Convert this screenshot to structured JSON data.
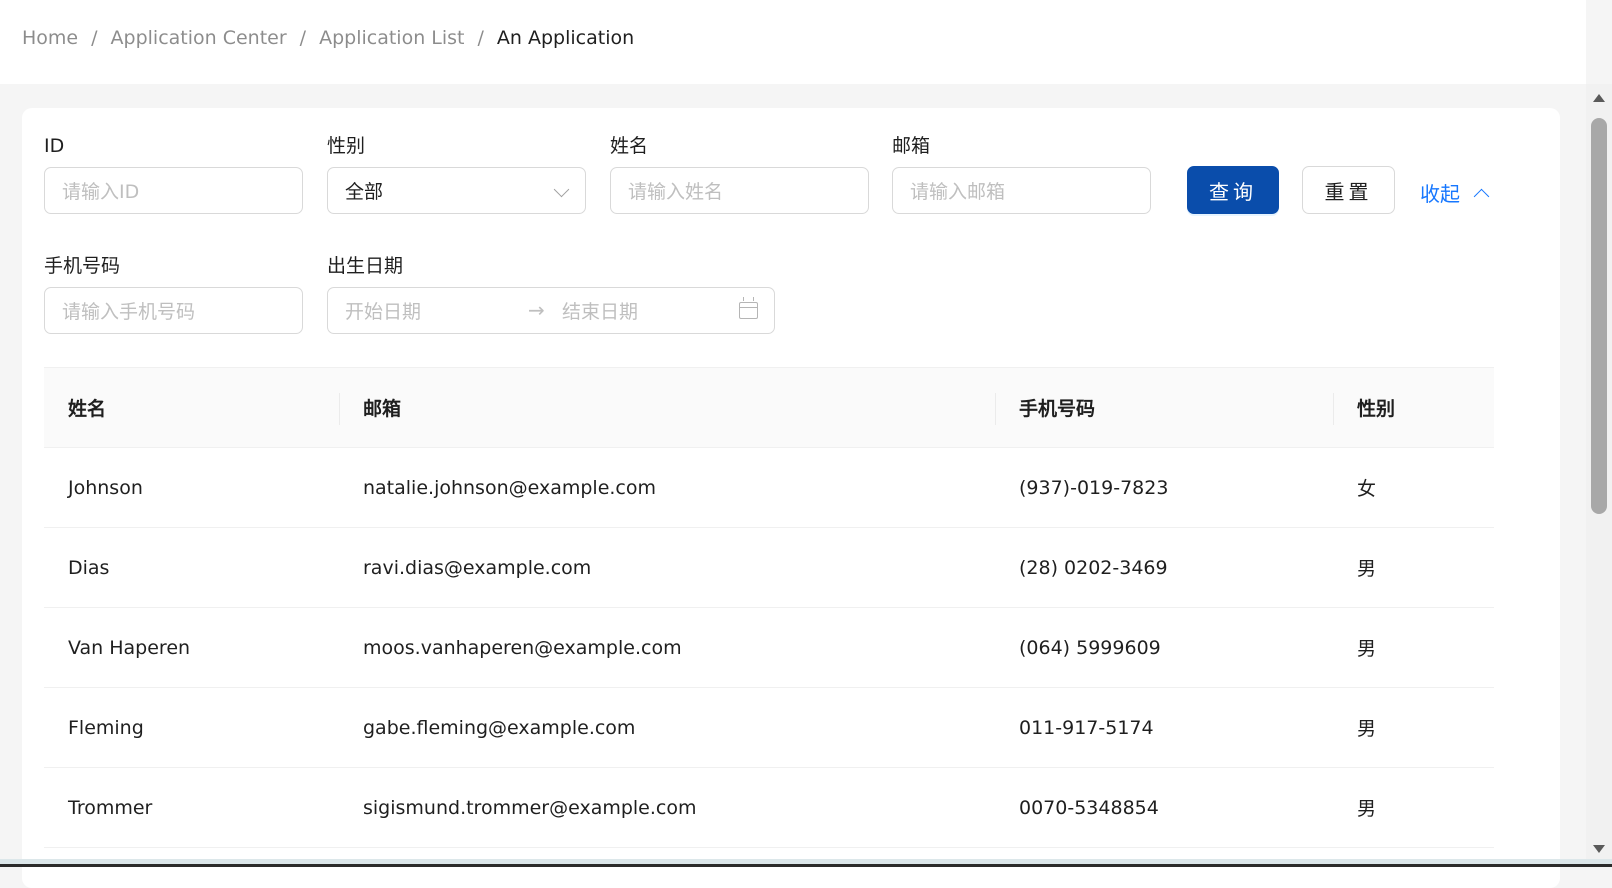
{
  "breadcrumb": {
    "items": [
      "Home",
      "Application Center",
      "Application List",
      "An Application"
    ],
    "separator": "/"
  },
  "filters": {
    "id": {
      "label": "ID",
      "placeholder": "请输入ID",
      "value": ""
    },
    "gender": {
      "label": "性别",
      "value": "全部"
    },
    "name": {
      "label": "姓名",
      "placeholder": "请输入姓名",
      "value": ""
    },
    "email": {
      "label": "邮箱",
      "placeholder": "请输入邮箱",
      "value": ""
    },
    "phone": {
      "label": "手机号码",
      "placeholder": "请输入手机号码",
      "value": ""
    },
    "birthdate": {
      "label": "出生日期",
      "start_placeholder": "开始日期",
      "end_placeholder": "结束日期",
      "arrow": "→"
    }
  },
  "actions": {
    "query_label": "查询",
    "reset_label": "重置",
    "collapse_label": "收起"
  },
  "table": {
    "columns": [
      "姓名",
      "邮箱",
      "手机号码",
      "性别"
    ],
    "rows": [
      [
        "Johnson",
        "natalie.johnson@example.com",
        "(937)-019-7823",
        "女"
      ],
      [
        "Dias",
        "ravi.dias@example.com",
        "(28) 0202-3469",
        "男"
      ],
      [
        "Van Haperen",
        "moos.vanhaperen@example.com",
        "(064) 5999609",
        "男"
      ],
      [
        "Fleming",
        "gabe.fleming@example.com",
        "011-917-5174",
        "男"
      ],
      [
        "Trommer",
        "sigismund.trommer@example.com",
        "0070-5348854",
        "男"
      ]
    ]
  },
  "colors": {
    "primary": "#0a4dab",
    "link": "#1677ff",
    "page_background": "#f5f5f5"
  },
  "icons": [
    "chevron-down-icon",
    "arrow-right-icon",
    "calendar-icon",
    "chevron-up-icon"
  ]
}
